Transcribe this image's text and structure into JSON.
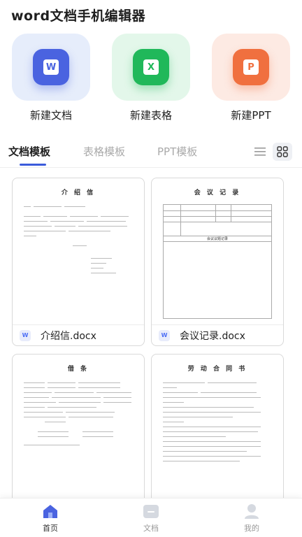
{
  "app": {
    "title": "word文档手机编辑器"
  },
  "create": [
    {
      "label": "新建文档",
      "glyph": "W",
      "tile_bg": "#e6edfb",
      "icon_bg": "#4a63e0",
      "glyph_color": "#4a63e0",
      "icon": "word-doc-icon"
    },
    {
      "label": "新建表格",
      "glyph": "X",
      "tile_bg": "#e3f7ea",
      "icon_bg": "#20b85a",
      "glyph_color": "#20b85a",
      "icon": "excel-sheet-icon"
    },
    {
      "label": "新建PPT",
      "glyph": "P",
      "tile_bg": "#fdeae3",
      "icon_bg": "#f0703f",
      "glyph_color": "#f0703f",
      "icon": "ppt-icon"
    }
  ],
  "tabs": [
    {
      "label": "文档模板",
      "active": true
    },
    {
      "label": "表格模板",
      "active": false
    },
    {
      "label": "PPT模板",
      "active": false
    }
  ],
  "templates": [
    {
      "name": "介绍信.docx",
      "title": "介 绍 信"
    },
    {
      "name": "会议记录.docx",
      "title": "会 议 记 录",
      "table_header": "会议议题记录"
    },
    {
      "title": "借 条"
    },
    {
      "title": "劳 动 合 同 书"
    }
  ],
  "nav": [
    {
      "label": "首页",
      "icon": "home-icon",
      "active": true
    },
    {
      "label": "文档",
      "icon": "document-folder-icon",
      "active": false
    },
    {
      "label": "我的",
      "icon": "profile-icon",
      "active": false
    }
  ],
  "colors": {
    "accent": "#3b5bdb",
    "inactive_text": "#aaaaaa"
  }
}
